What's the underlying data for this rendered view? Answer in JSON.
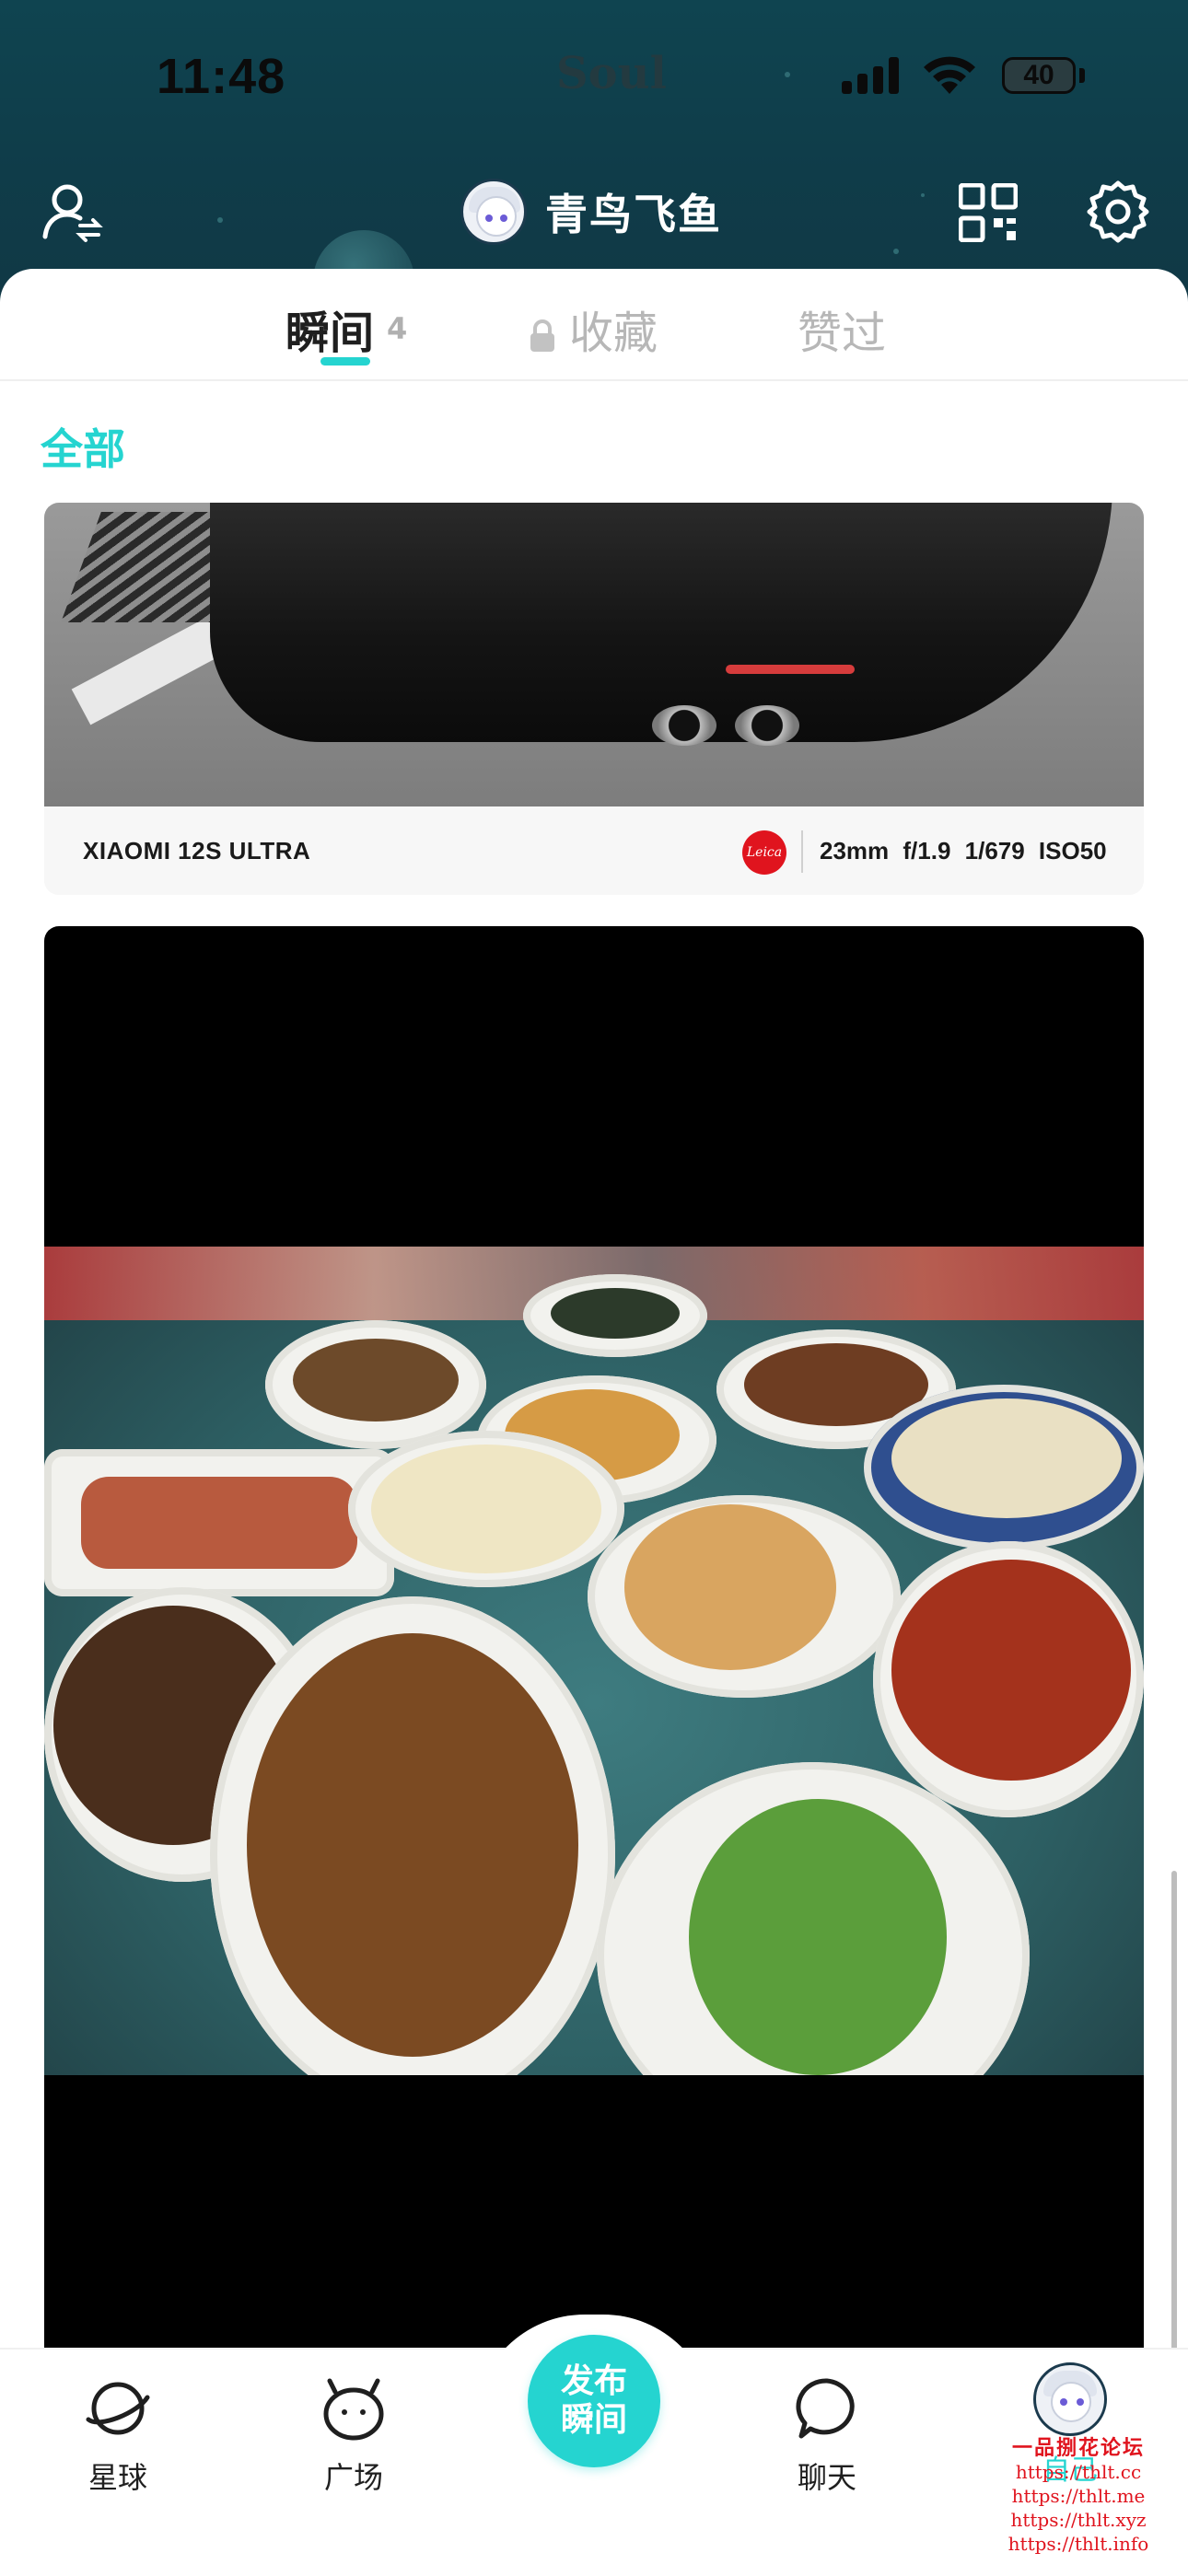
{
  "status_bar": {
    "time": "11:48",
    "carrier_logo": "Soul",
    "battery": "40"
  },
  "header": {
    "nickname": "青鸟飞鱼",
    "icons": [
      "profile-switch-icon",
      "qr-code-icon",
      "gear-icon"
    ]
  },
  "tabs": [
    {
      "label": "瞬间",
      "count": "4",
      "active": true
    },
    {
      "label": "收藏",
      "locked": true
    },
    {
      "label": "赞过"
    }
  ],
  "filter": {
    "label": "全部"
  },
  "posts": [
    {
      "type": "photo",
      "exif": {
        "model": "XIAOMI 12S ULTRA",
        "brand_badge": "Leica",
        "params": "23mm  f/1.9  1/679  ISO50"
      }
    },
    {
      "type": "photo"
    }
  ],
  "tabbar": {
    "items": [
      {
        "label": "星球",
        "icon": "planet-icon"
      },
      {
        "label": "广场",
        "icon": "square-face-icon"
      },
      {
        "label": "发布瞬间",
        "icon": "publish-button",
        "line1": "发布",
        "line2": "瞬间"
      },
      {
        "label": "聊天",
        "icon": "chat-bubble-icon"
      },
      {
        "label": "自己",
        "icon": "avatar"
      }
    ]
  },
  "watermark": {
    "title": "一品捌花论坛",
    "urls": [
      "https://thlt.cc",
      "https://thlt.me",
      "https://thlt.xyz",
      "https://thlt.info"
    ]
  },
  "colors": {
    "accent": "#25d4d0",
    "header_bg": "#0f4450",
    "text": "#1f1f1f"
  }
}
